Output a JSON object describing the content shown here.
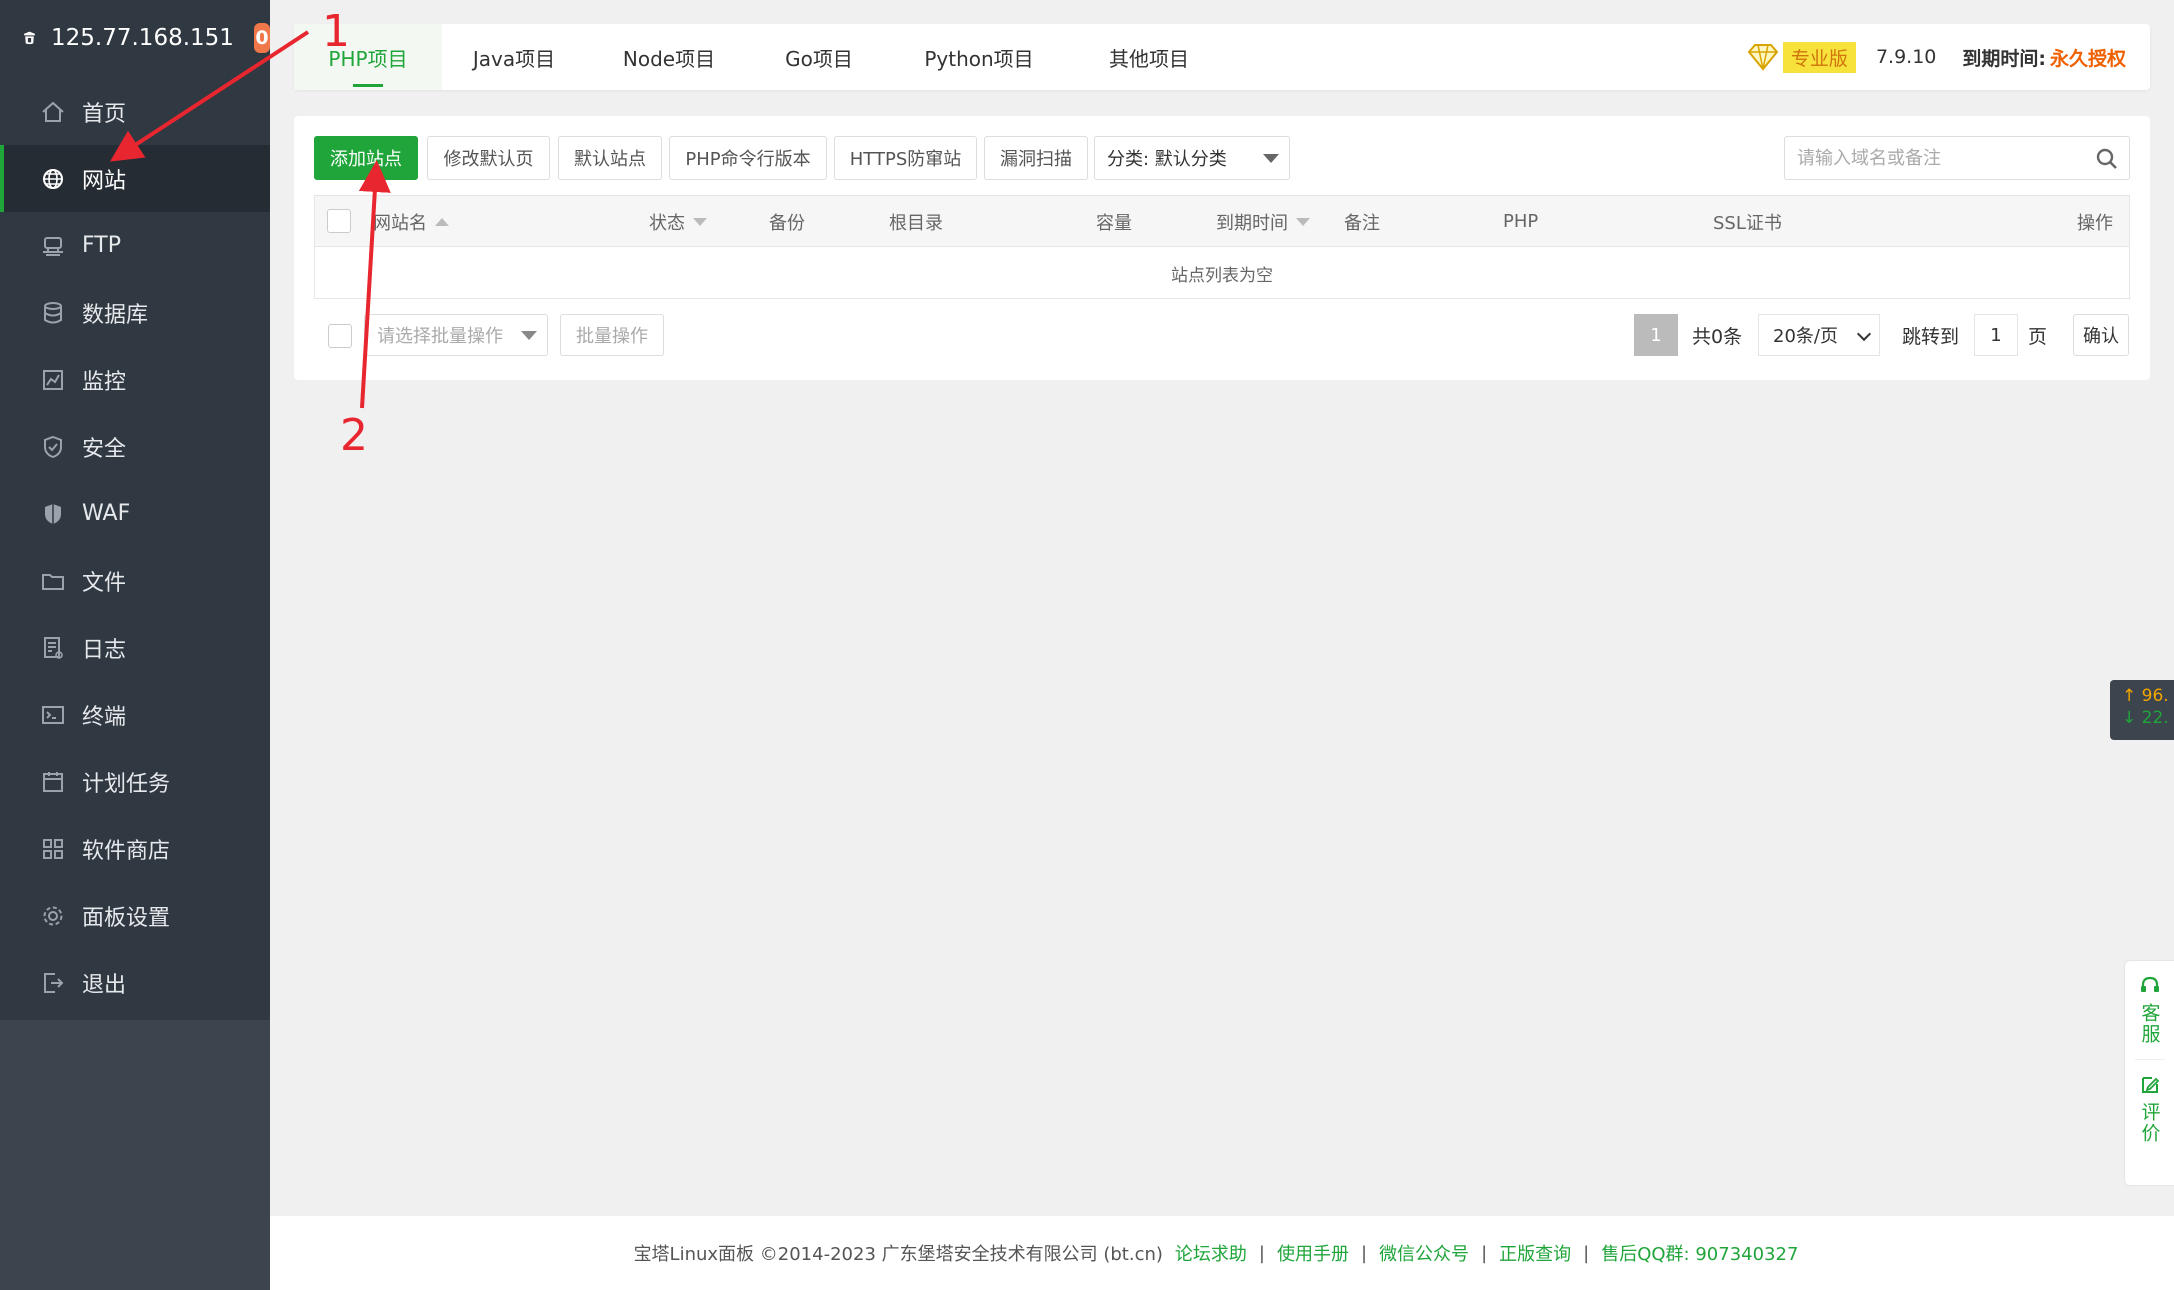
{
  "sidebar": {
    "ip": "125.77.168.151",
    "badge": "0",
    "items": [
      {
        "label": "首页",
        "icon": "home-icon"
      },
      {
        "label": "网站",
        "icon": "globe-icon",
        "active": true
      },
      {
        "label": "FTP",
        "icon": "ftp-icon"
      },
      {
        "label": "数据库",
        "icon": "database-icon"
      },
      {
        "label": "监控",
        "icon": "monitor-icon"
      },
      {
        "label": "安全",
        "icon": "shield-icon"
      },
      {
        "label": "WAF",
        "icon": "waf-shield-icon"
      },
      {
        "label": "文件",
        "icon": "folder-icon"
      },
      {
        "label": "日志",
        "icon": "log-icon"
      },
      {
        "label": "终端",
        "icon": "terminal-icon"
      },
      {
        "label": "计划任务",
        "icon": "calendar-icon"
      },
      {
        "label": "软件商店",
        "icon": "apps-grid-icon"
      },
      {
        "label": "面板设置",
        "icon": "gear-icon"
      },
      {
        "label": "退出",
        "icon": "logout-icon"
      }
    ]
  },
  "tabs": [
    "PHP项目",
    "Java项目",
    "Node项目",
    "Go项目",
    "Python项目",
    "其他项目"
  ],
  "header": {
    "pro_label": "专业版",
    "version": "7.9.10",
    "expire_label": "到期时间:",
    "expire_value": "永久授权"
  },
  "toolbar": {
    "add_site": "添加站点",
    "modify_default_page": "修改默认页",
    "default_site": "默认站点",
    "php_cli": "PHP命令行版本",
    "https_guard": "HTTPS防窜站",
    "vuln_scan": "漏洞扫描",
    "category": "分类: 默认分类",
    "search_placeholder": "请输入域名或备注"
  },
  "table": {
    "columns": [
      "网站名",
      "状态",
      "备份",
      "根目录",
      "容量",
      "到期时间",
      "备注",
      "PHP",
      "SSL证书",
      "操作"
    ],
    "empty_text": "站点列表为空"
  },
  "bottom": {
    "batch_placeholder": "请选择批量操作",
    "batch_button": "批量操作",
    "page_current": "1",
    "total": "共0条",
    "per_page": "20条/页",
    "jump_label": "跳转到",
    "jump_value": "1",
    "page_unit": "页",
    "confirm": "确认"
  },
  "footer": {
    "copyright": "宝塔Linux面板 ©2014-2023 广东堡塔安全技术有限公司 (bt.cn)",
    "links": [
      "论坛求助",
      "使用手册",
      "微信公众号",
      "正版查询",
      "售后QQ群: 907340327"
    ]
  },
  "netspeed": {
    "up": "↑ 96.",
    "down": "↓ 22."
  },
  "side_widgets": {
    "service": "客服",
    "review": "评价"
  },
  "annotations": {
    "one": "1",
    "two": "2"
  },
  "colors": {
    "accent": "#20a53a",
    "sidebar": "#303841",
    "annotation": "#e8262f",
    "badge": "#f0774a"
  }
}
